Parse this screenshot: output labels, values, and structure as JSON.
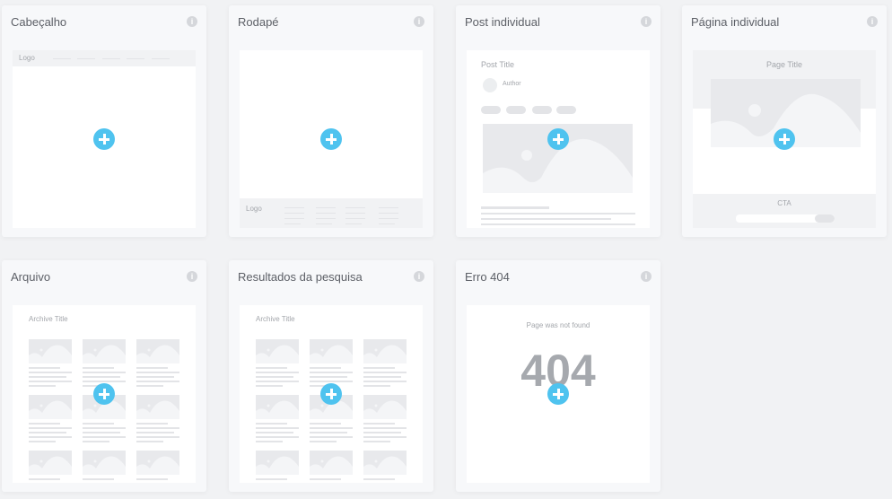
{
  "templates": [
    {
      "title": "Cabeçalho",
      "preview": {
        "logo": "Logo"
      }
    },
    {
      "title": "Rodapé",
      "preview": {
        "logo": "Logo"
      }
    },
    {
      "title": "Post individual",
      "preview": {
        "post_title": "Post Title",
        "author": "Author"
      }
    },
    {
      "title": "Página individual",
      "preview": {
        "page_title": "Page Title",
        "cta": "CTA"
      }
    },
    {
      "title": "Arquivo",
      "preview": {
        "archive_title": "Archive Title"
      }
    },
    {
      "title": "Resultados da pesquisa",
      "preview": {
        "archive_title": "Archive Title"
      }
    },
    {
      "title": "Erro 404",
      "preview": {
        "message": "Page was not found",
        "code": "404"
      }
    }
  ],
  "icons": {
    "info": "info-icon",
    "add": "plus-circle-icon",
    "image": "image-placeholder-icon"
  },
  "colors": {
    "accent": "#4fc3ef",
    "background": "#f1f2f4",
    "card": "#f7f8fa"
  }
}
